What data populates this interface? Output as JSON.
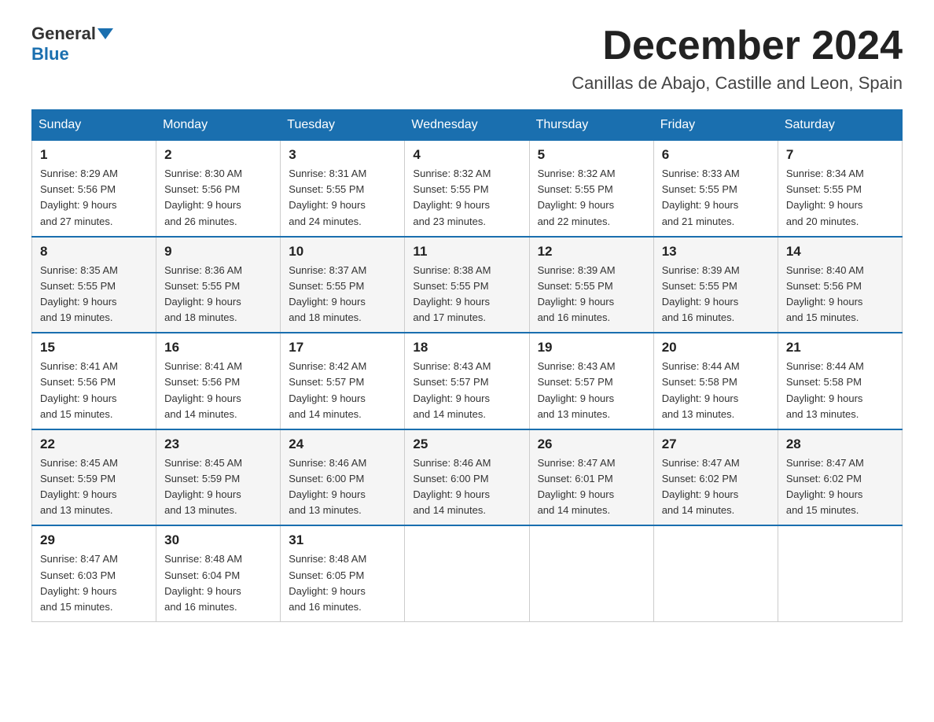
{
  "logo": {
    "general": "General",
    "blue": "Blue"
  },
  "header": {
    "month": "December 2024",
    "location": "Canillas de Abajo, Castille and Leon, Spain"
  },
  "weekdays": [
    "Sunday",
    "Monday",
    "Tuesday",
    "Wednesday",
    "Thursday",
    "Friday",
    "Saturday"
  ],
  "weeks": [
    [
      {
        "day": "1",
        "sunrise": "8:29 AM",
        "sunset": "5:56 PM",
        "daylight": "9 hours and 27 minutes."
      },
      {
        "day": "2",
        "sunrise": "8:30 AM",
        "sunset": "5:56 PM",
        "daylight": "9 hours and 26 minutes."
      },
      {
        "day": "3",
        "sunrise": "8:31 AM",
        "sunset": "5:55 PM",
        "daylight": "9 hours and 24 minutes."
      },
      {
        "day": "4",
        "sunrise": "8:32 AM",
        "sunset": "5:55 PM",
        "daylight": "9 hours and 23 minutes."
      },
      {
        "day": "5",
        "sunrise": "8:32 AM",
        "sunset": "5:55 PM",
        "daylight": "9 hours and 22 minutes."
      },
      {
        "day": "6",
        "sunrise": "8:33 AM",
        "sunset": "5:55 PM",
        "daylight": "9 hours and 21 minutes."
      },
      {
        "day": "7",
        "sunrise": "8:34 AM",
        "sunset": "5:55 PM",
        "daylight": "9 hours and 20 minutes."
      }
    ],
    [
      {
        "day": "8",
        "sunrise": "8:35 AM",
        "sunset": "5:55 PM",
        "daylight": "9 hours and 19 minutes."
      },
      {
        "day": "9",
        "sunrise": "8:36 AM",
        "sunset": "5:55 PM",
        "daylight": "9 hours and 18 minutes."
      },
      {
        "day": "10",
        "sunrise": "8:37 AM",
        "sunset": "5:55 PM",
        "daylight": "9 hours and 18 minutes."
      },
      {
        "day": "11",
        "sunrise": "8:38 AM",
        "sunset": "5:55 PM",
        "daylight": "9 hours and 17 minutes."
      },
      {
        "day": "12",
        "sunrise": "8:39 AM",
        "sunset": "5:55 PM",
        "daylight": "9 hours and 16 minutes."
      },
      {
        "day": "13",
        "sunrise": "8:39 AM",
        "sunset": "5:55 PM",
        "daylight": "9 hours and 16 minutes."
      },
      {
        "day": "14",
        "sunrise": "8:40 AM",
        "sunset": "5:56 PM",
        "daylight": "9 hours and 15 minutes."
      }
    ],
    [
      {
        "day": "15",
        "sunrise": "8:41 AM",
        "sunset": "5:56 PM",
        "daylight": "9 hours and 15 minutes."
      },
      {
        "day": "16",
        "sunrise": "8:41 AM",
        "sunset": "5:56 PM",
        "daylight": "9 hours and 14 minutes."
      },
      {
        "day": "17",
        "sunrise": "8:42 AM",
        "sunset": "5:57 PM",
        "daylight": "9 hours and 14 minutes."
      },
      {
        "day": "18",
        "sunrise": "8:43 AM",
        "sunset": "5:57 PM",
        "daylight": "9 hours and 14 minutes."
      },
      {
        "day": "19",
        "sunrise": "8:43 AM",
        "sunset": "5:57 PM",
        "daylight": "9 hours and 13 minutes."
      },
      {
        "day": "20",
        "sunrise": "8:44 AM",
        "sunset": "5:58 PM",
        "daylight": "9 hours and 13 minutes."
      },
      {
        "day": "21",
        "sunrise": "8:44 AM",
        "sunset": "5:58 PM",
        "daylight": "9 hours and 13 minutes."
      }
    ],
    [
      {
        "day": "22",
        "sunrise": "8:45 AM",
        "sunset": "5:59 PM",
        "daylight": "9 hours and 13 minutes."
      },
      {
        "day": "23",
        "sunrise": "8:45 AM",
        "sunset": "5:59 PM",
        "daylight": "9 hours and 13 minutes."
      },
      {
        "day": "24",
        "sunrise": "8:46 AM",
        "sunset": "6:00 PM",
        "daylight": "9 hours and 13 minutes."
      },
      {
        "day": "25",
        "sunrise": "8:46 AM",
        "sunset": "6:00 PM",
        "daylight": "9 hours and 14 minutes."
      },
      {
        "day": "26",
        "sunrise": "8:47 AM",
        "sunset": "6:01 PM",
        "daylight": "9 hours and 14 minutes."
      },
      {
        "day": "27",
        "sunrise": "8:47 AM",
        "sunset": "6:02 PM",
        "daylight": "9 hours and 14 minutes."
      },
      {
        "day": "28",
        "sunrise": "8:47 AM",
        "sunset": "6:02 PM",
        "daylight": "9 hours and 15 minutes."
      }
    ],
    [
      {
        "day": "29",
        "sunrise": "8:47 AM",
        "sunset": "6:03 PM",
        "daylight": "9 hours and 15 minutes."
      },
      {
        "day": "30",
        "sunrise": "8:48 AM",
        "sunset": "6:04 PM",
        "daylight": "9 hours and 16 minutes."
      },
      {
        "day": "31",
        "sunrise": "8:48 AM",
        "sunset": "6:05 PM",
        "daylight": "9 hours and 16 minutes."
      },
      null,
      null,
      null,
      null
    ]
  ]
}
